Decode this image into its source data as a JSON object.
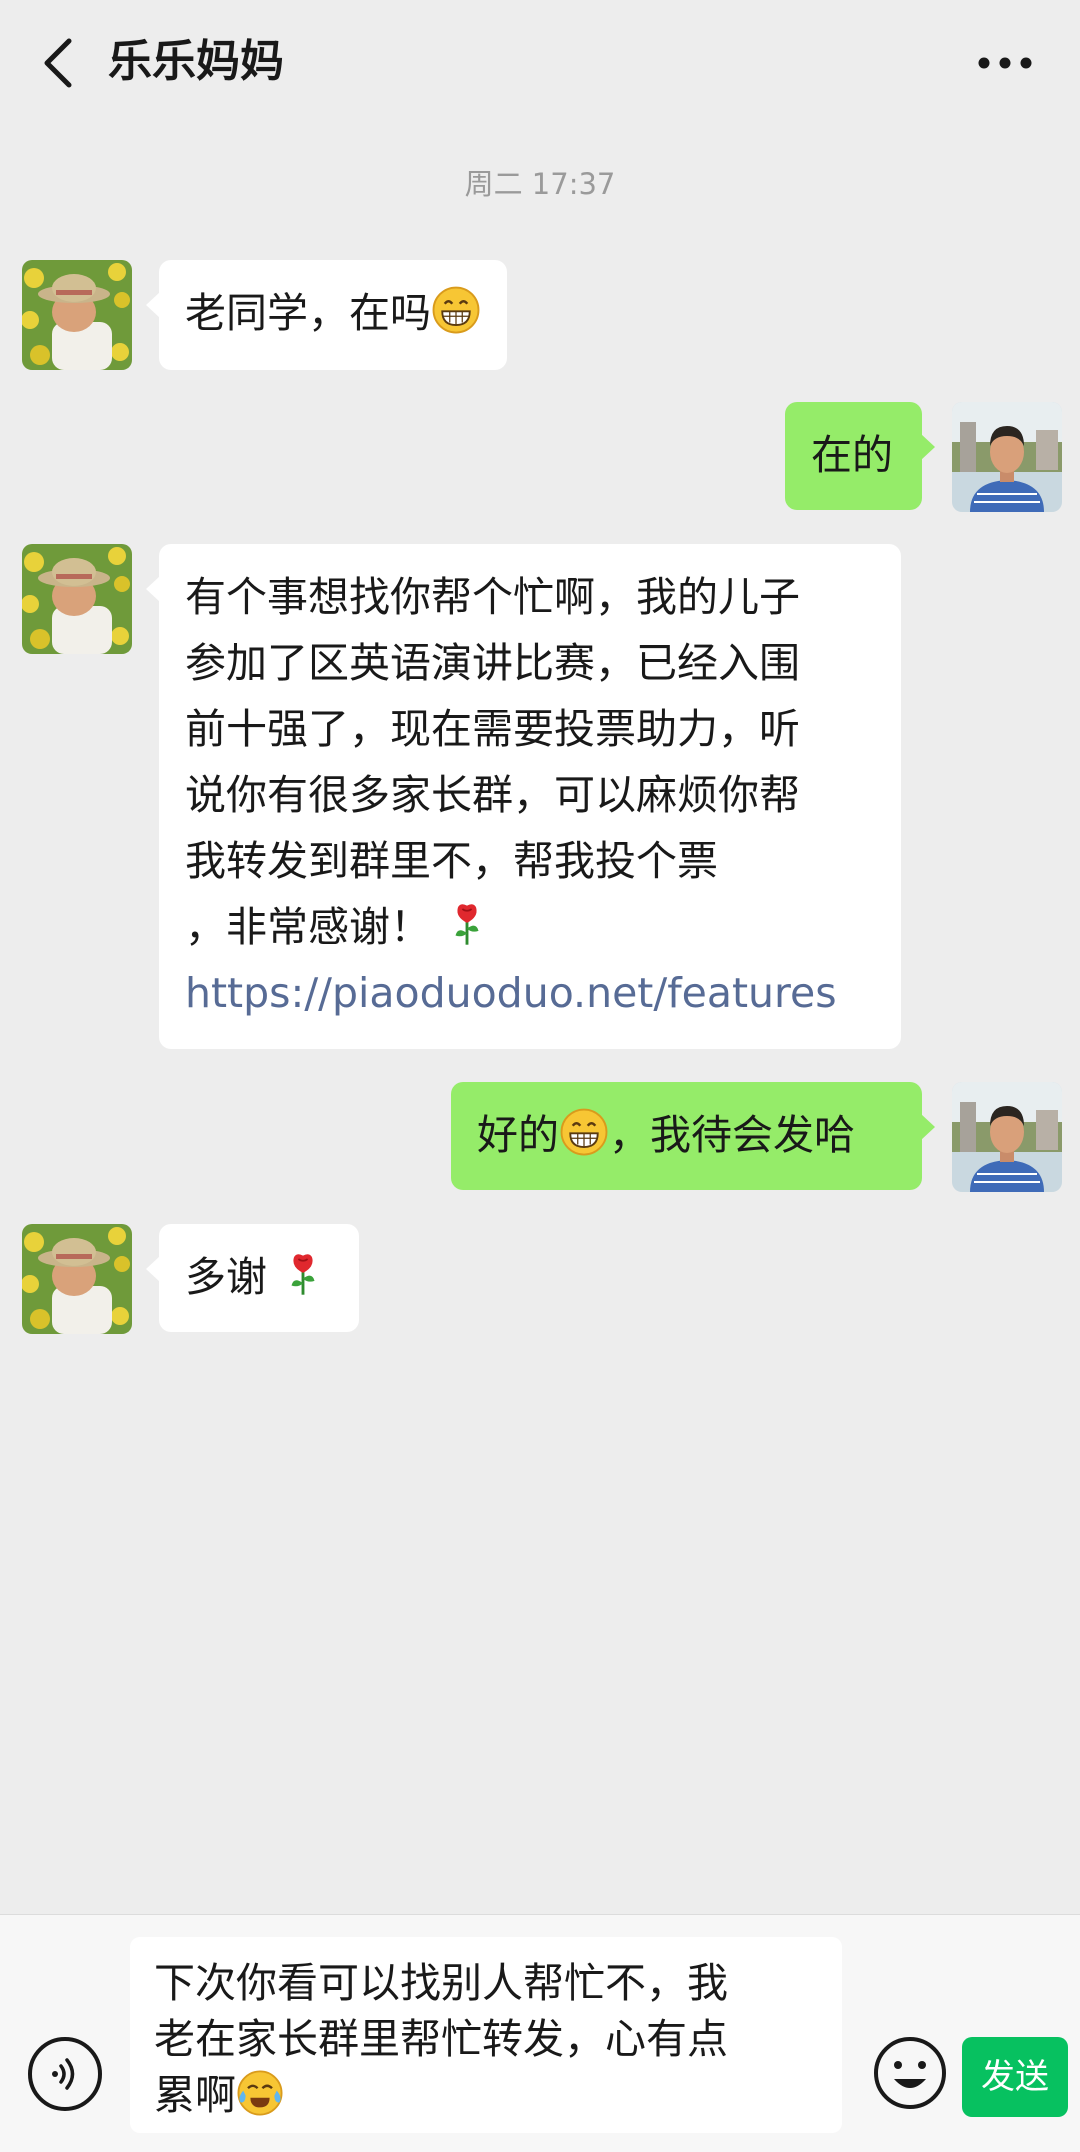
{
  "header": {
    "title": "乐乐妈妈",
    "back_icon": "chevron-left-icon",
    "more_icon": "more-dots-icon"
  },
  "timestamp": "周二 17:37",
  "messages": [
    {
      "side": "in",
      "avatar": "child-avatar",
      "text": "老同学，在吗",
      "emoji": "grin-emoji"
    },
    {
      "side": "out",
      "avatar": "man-avatar",
      "text": "在的"
    },
    {
      "side": "in",
      "avatar": "child-avatar",
      "lines": [
        "有个事想找你帮个忙啊，我的儿子",
        "参加了区英语演讲比赛，已经入围",
        "前十强了，现在需要投票助力，听",
        "说你有很多家长群，可以麻烦你帮",
        "我转发到群里不，帮我投个票",
        "，非常感谢！"
      ],
      "emoji": "rose-emoji",
      "link": "https://piaoduoduo.net/features"
    },
    {
      "side": "out",
      "avatar": "man-avatar",
      "text_before": "好的",
      "emoji": "grin-emoji",
      "text_after": "，我待会发哈"
    },
    {
      "side": "in",
      "avatar": "child-avatar",
      "text": "多谢",
      "emoji": "rose-emoji"
    }
  ],
  "input": {
    "lines": [
      "下次你看可以找别人帮忙不，我",
      "老在家长群里帮忙转发，心有点",
      "累啊"
    ],
    "emoji": "tears-of-joy-emoji"
  },
  "toolbar": {
    "voice_icon": "voice-icon",
    "emoji_icon": "smiley-icon",
    "send_label": "发送"
  },
  "colors": {
    "background": "#ededed",
    "incoming_bubble": "#ffffff",
    "outgoing_bubble": "#95ec69",
    "link": "#576b95",
    "send_button": "#07c160"
  }
}
